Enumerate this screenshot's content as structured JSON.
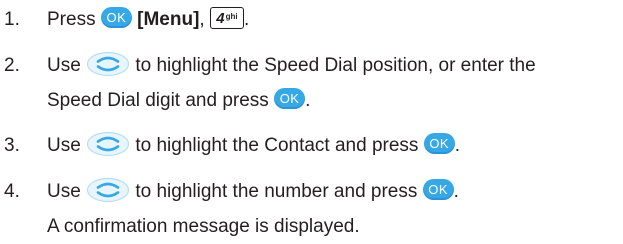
{
  "steps": [
    {
      "number": "1.",
      "text_a": "Press",
      "ok_label": "OK",
      "menu_label": "[Menu]",
      "comma": ",",
      "key_digit": "4",
      "key_letters": "ghi",
      "period": "."
    },
    {
      "number": "2.",
      "line1_a": "Use",
      "line1_b": "to highlight the Speed Dial position, or enter the",
      "line2_a": "Speed Dial digit and press",
      "ok_label": "OK",
      "period": "."
    },
    {
      "number": "3.",
      "text_a": "Use",
      "text_b": "to highlight the Contact and press",
      "ok_label": "OK",
      "period": "."
    },
    {
      "number": "4.",
      "text_a": "Use",
      "text_b": "to highlight the number and press",
      "ok_label": "OK",
      "period": ".",
      "line2": "A confirmation message is displayed."
    }
  ],
  "icons": {
    "ok": "ok-key-icon",
    "nav": "navigation-key-icon",
    "number_key": "number-key-4-icon"
  },
  "colors": {
    "text": "#231f20",
    "ok_key": "#36a8e6",
    "nav_key_fill": "#e8f5fd",
    "nav_key_stroke": "#36a8e6"
  }
}
